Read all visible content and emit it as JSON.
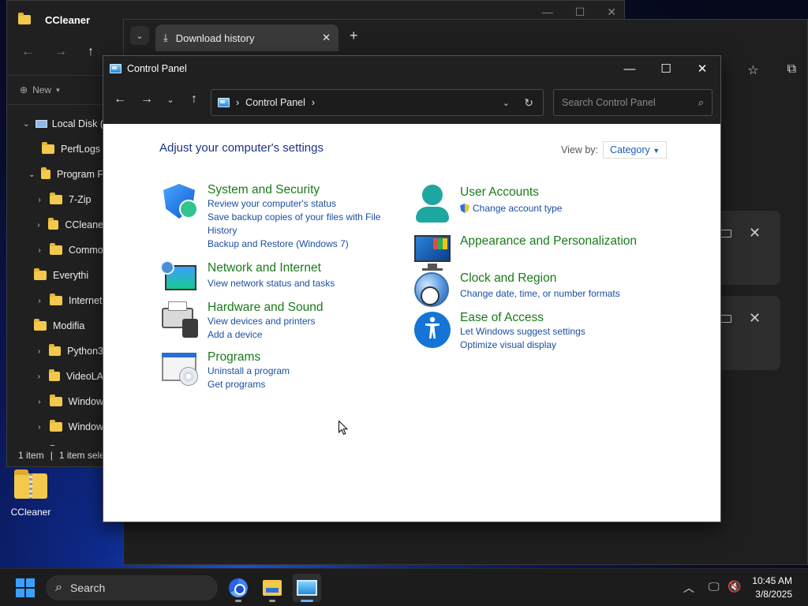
{
  "explorer": {
    "title": "CCleaner",
    "new_label": "New",
    "tree": [
      {
        "label": "Local Disk (",
        "chevron": "v",
        "kind": "drive"
      },
      {
        "label": "PerfLogs",
        "chevron": "",
        "kind": "folder"
      },
      {
        "label": "Program F",
        "chevron": "v",
        "kind": "folder"
      },
      {
        "label": "7-Zip",
        "chevron": ">",
        "kind": "folder"
      },
      {
        "label": "CCleane",
        "chevron": ">",
        "kind": "folder"
      },
      {
        "label": "Commo",
        "chevron": ">",
        "kind": "folder"
      },
      {
        "label": "Everythi",
        "chevron": "",
        "kind": "folder"
      },
      {
        "label": "Internet",
        "chevron": ">",
        "kind": "folder"
      },
      {
        "label": "Modifia",
        "chevron": "",
        "kind": "folder"
      },
      {
        "label": "Python3",
        "chevron": ">",
        "kind": "folder"
      },
      {
        "label": "VideoLA",
        "chevron": ">",
        "kind": "folder"
      },
      {
        "label": "Window",
        "chevron": ">",
        "kind": "folder"
      },
      {
        "label": "Window",
        "chevron": ">",
        "kind": "folder"
      },
      {
        "label": "Window",
        "chevron": ">",
        "kind": "folder"
      }
    ],
    "status_items": "1 item",
    "status_selected": "1 item sele"
  },
  "browser": {
    "tab_title": "Download history"
  },
  "control_panel": {
    "window_title": "Control Panel",
    "breadcrumb": "Control Panel",
    "search_placeholder": "Search Control Panel",
    "heading": "Adjust your computer's settings",
    "view_by_label": "View by:",
    "view_by_value": "Category",
    "categories": {
      "system_security": {
        "title": "System and Security",
        "links": [
          "Review your computer's status",
          "Save backup copies of your files with File History",
          "Backup and Restore (Windows 7)"
        ]
      },
      "network": {
        "title": "Network and Internet",
        "links": [
          "View network status and tasks"
        ]
      },
      "hardware": {
        "title": "Hardware and Sound",
        "links": [
          "View devices and printers",
          "Add a device"
        ]
      },
      "programs": {
        "title": "Programs",
        "links": [
          "Uninstall a program",
          "Get programs"
        ]
      },
      "user_accounts": {
        "title": "User Accounts",
        "links": [
          "Change account type"
        ]
      },
      "appearance": {
        "title": "Appearance and Personalization",
        "links": []
      },
      "clock_region": {
        "title": "Clock and Region",
        "links": [
          "Change date, time, or number formats"
        ]
      },
      "ease_access": {
        "title": "Ease of Access",
        "links": [
          "Let Windows suggest settings",
          "Optimize visual display"
        ]
      }
    }
  },
  "desktop": {
    "icon_label": "CCleaner"
  },
  "taskbar": {
    "search_label": "Search",
    "time": "10:45 AM",
    "date": "3/8/2025"
  },
  "colors": {
    "category_title": "#1a7a1a",
    "link": "#1c4fa0",
    "heading": "#1e3287",
    "accent": "#5fb2ff"
  }
}
